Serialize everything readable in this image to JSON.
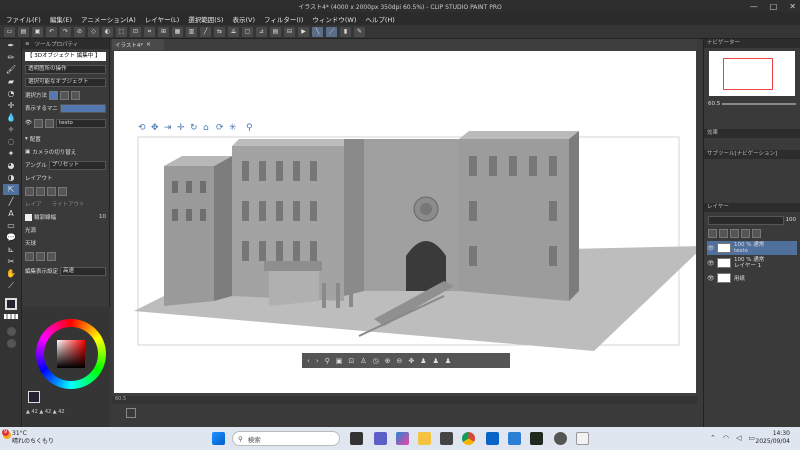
{
  "window": {
    "title": "イラスト4* (4000 x 2000px 350dpi 60.5%) - CLIP STUDIO PAINT PRO",
    "min": "—",
    "max": "□",
    "close": "✕"
  },
  "menu": [
    "ファイル(F)",
    "編集(E)",
    "アニメーション(A)",
    "レイヤー(L)",
    "選択範囲(S)",
    "表示(V)",
    "フィルター(I)",
    "ウィンドウ(W)",
    "ヘルプ(H)"
  ],
  "tool_property": {
    "tab_label": "ツールプロパティ",
    "title": "【 3Dオブジェクト 編集中 】",
    "row1": "透明箇所の操作",
    "row2": "選択可能なオブジェクト",
    "row3_label": "選択方法",
    "row4_label": "表示するマニ",
    "object_name": "testo",
    "section_arrange": "配置",
    "camera_switch": "カメラの切り替え",
    "angle_label": "アングル",
    "angle_value": "プリセット",
    "layout_label": "レイアウト",
    "layout_item1": "レイア",
    "layout_item2": "ライトアウト",
    "outline_label": "輪郭線幅",
    "outline_value": "10",
    "light_label": "光源",
    "sky_label": "天球",
    "edit_label": "編集表示設定",
    "edit_value": "高速"
  },
  "canvas": {
    "doc_tab": "イラスト4*",
    "zoom_readout": "60.5"
  },
  "right_panel": {
    "nav_tab": "ナビゲーター",
    "nav_zoom": "60.5",
    "effects_tab": "効果",
    "sub_tab": "サブツール[ナビゲーション]",
    "layer_tab": "レイヤー",
    "opacity": "100",
    "layers": [
      {
        "name": "100 % 通常",
        "sub": "testo",
        "selected": true
      },
      {
        "name": "100 % 通常",
        "sub": "レイヤー 1",
        "selected": false
      },
      {
        "name": "用紙",
        "sub": "",
        "selected": false
      }
    ]
  },
  "taskbar": {
    "weather_temp": "31°C",
    "weather_text": "晴れのちくもり",
    "search_placeholder": "検索",
    "time": "14:30",
    "date": "2025/09/04",
    "badge": "9"
  },
  "colors": {
    "accent": "#4f6f9c",
    "panel": "#3a3a3a",
    "taskbar": "#dfe6ef"
  }
}
